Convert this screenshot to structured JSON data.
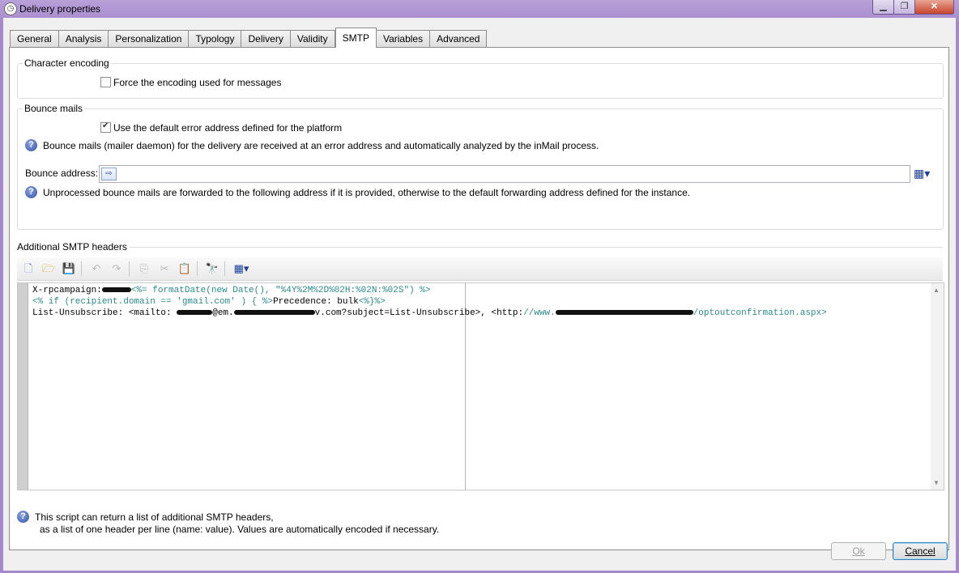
{
  "window": {
    "title": "Delivery properties",
    "minimize": "▁",
    "maximize": "❐",
    "close": "✕"
  },
  "tabs": [
    {
      "label": "General"
    },
    {
      "label": "Analysis"
    },
    {
      "label": "Personalization"
    },
    {
      "label": "Typology"
    },
    {
      "label": "Delivery"
    },
    {
      "label": "Validity"
    },
    {
      "label": "SMTP"
    },
    {
      "label": "Variables"
    },
    {
      "label": "Advanced"
    }
  ],
  "active_tab": "SMTP",
  "character_encoding": {
    "title": "Character encoding",
    "force_encoding_label": "Force the encoding used for messages",
    "force_encoding_checked": false
  },
  "bounce_mails": {
    "title": "Bounce mails",
    "use_default_label": "Use the default error address defined for the platform",
    "use_default_checked": true,
    "info_1": "Bounce mails (mailer daemon) for the delivery are received at an error address and automatically analyzed by the inMail process.",
    "bounce_address_label": "Bounce address:",
    "bounce_address_value": "",
    "info_2": "Unprocessed bounce mails are forwarded to the following address if it is provided, otherwise to the default forwarding address defined for the instance."
  },
  "smtp_headers": {
    "title": "Additional SMTP headers",
    "toolbar_icons": [
      "new-document-icon",
      "open-folder-icon",
      "save-icon",
      "undo-icon",
      "redo-icon",
      "copy-icon",
      "cut-icon",
      "paste-icon",
      "find-icon",
      "function-icon"
    ],
    "code": {
      "line1_a": "X-rpcampaign:",
      "line1_b": "<%= formatDate(new Date(), \"%4Y%2M%2D%02H:%02N:%02S\") %>",
      "line2_a": "<% if (recipient.domain == 'gmail.com' ) { %>",
      "line2_b": "Precedence: bulk",
      "line2_c": "<%}%>",
      "line3_a": "List-Unsubscribe: <mailto: ",
      "line3_b": "@em.",
      "line3_c": "v.com?subject=List-Unsubscribe>, <http:",
      "line3_d": "//www.",
      "line3_e": "/optoutconfirmation.aspx>"
    },
    "help_line1": "This script can return a list of additional SMTP headers,",
    "help_line2": "as a list of one header per line (name: value). Values are automatically encoded if necessary."
  },
  "buttons": {
    "ok": "Ok",
    "cancel": "Cancel"
  }
}
